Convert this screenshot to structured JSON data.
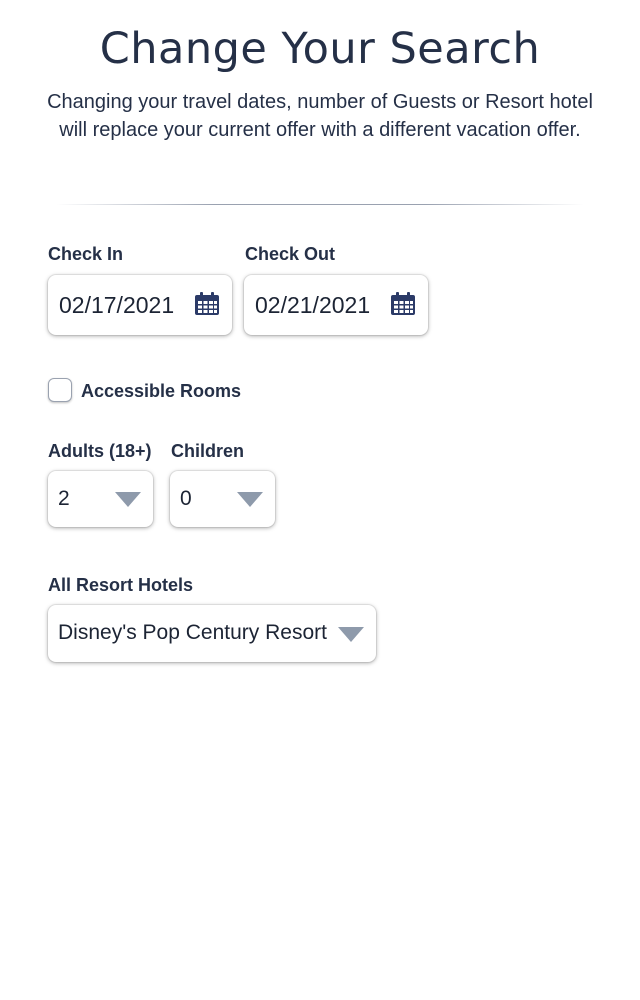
{
  "header": {
    "title": "Change Your Search",
    "subtitle": "Changing your travel dates, number of Guests or Resort hotel will replace your current offer with a different vacation offer."
  },
  "dates": {
    "check_in_label": "Check In",
    "check_in_value": "02/17/2021",
    "check_out_label": "Check Out",
    "check_out_value": "02/21/2021",
    "icon": "calendar-icon"
  },
  "accessible": {
    "label": "Accessible Rooms",
    "checked": false
  },
  "guests": {
    "adults_label": "Adults (18+)",
    "adults_value": "2",
    "children_label": "Children",
    "children_value": "0"
  },
  "resort": {
    "label": "All Resort Hotels",
    "value": "Disney's Pop Century Resort"
  },
  "colors": {
    "text": "#253047",
    "icon": "#2b3a67",
    "dropdown_arrow": "#8e9aab"
  }
}
